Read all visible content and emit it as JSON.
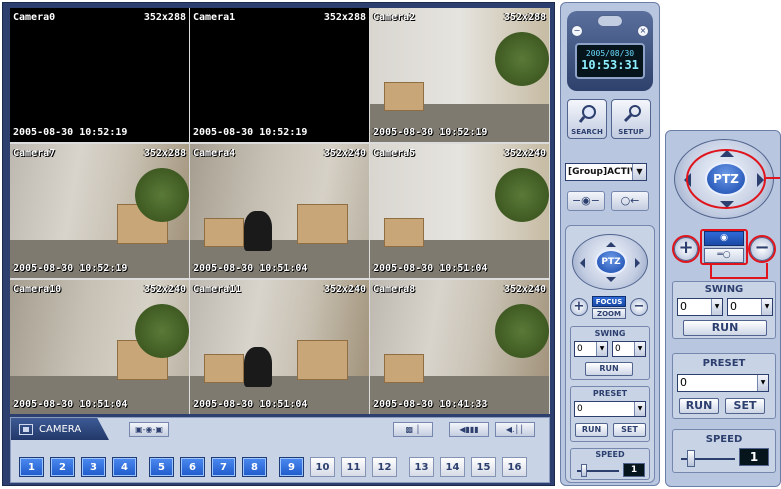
{
  "cameras": [
    {
      "name": "Camera0",
      "res": "352x288",
      "time": "2005-08-30 10:52:19",
      "live": false
    },
    {
      "name": "Camera1",
      "res": "352x288",
      "time": "2005-08-30 10:52:19",
      "live": false
    },
    {
      "name": "Camera2",
      "res": "352x288",
      "time": "2005-08-30 10:52:19",
      "live": true
    },
    {
      "name": "Camera7",
      "res": "352x288",
      "time": "2005-08-30 10:52:19",
      "live": true
    },
    {
      "name": "Camera4",
      "res": "352x240",
      "time": "2005-08-30 10:51:04",
      "live": true
    },
    {
      "name": "Camera5",
      "res": "352x240",
      "time": "2005-08-30 10:51:04",
      "live": true
    },
    {
      "name": "Camera10",
      "res": "352x240",
      "time": "2005-08-30 10:51:04",
      "live": true
    },
    {
      "name": "Camera11",
      "res": "352x240",
      "time": "2005-08-30 10:51:04",
      "live": true
    },
    {
      "name": "Camera8",
      "res": "352x240",
      "time": "2005-08-30 10:41:33",
      "live": true
    }
  ],
  "bottombar": {
    "tab_label": "CAMERA",
    "channel_buttons": [
      {
        "label": "1",
        "on": true
      },
      {
        "label": "2",
        "on": true
      },
      {
        "label": "3",
        "on": true
      },
      {
        "label": "4",
        "on": true
      },
      {
        "label": "5",
        "on": true
      },
      {
        "label": "6",
        "on": true
      },
      {
        "label": "7",
        "on": true
      },
      {
        "label": "8",
        "on": true
      },
      {
        "label": "9",
        "on": true
      },
      {
        "label": "10",
        "on": false
      },
      {
        "label": "11",
        "on": false
      },
      {
        "label": "12",
        "on": false
      },
      {
        "label": "13",
        "on": false
      },
      {
        "label": "14",
        "on": false
      },
      {
        "label": "15",
        "on": false
      },
      {
        "label": "16",
        "on": false
      }
    ]
  },
  "side": {
    "clock_date": "2005/08/30",
    "clock_time": "10:53:31",
    "search_label": "SEARCH",
    "setup_label": "SETUP",
    "group_value": "[Group]ACTIV",
    "ptz_label": "PTZ",
    "focus_label": "FOCUS",
    "zoom_label": "ZOOM",
    "swing_title": "SWING",
    "swing_a": "0",
    "swing_b": "0",
    "run_label": "RUN",
    "preset_title": "PRESET",
    "preset_value": "0",
    "set_label": "SET",
    "speed_title": "SPEED",
    "speed_value": "1"
  },
  "colors": {
    "accent": "#2e5fbd",
    "panel": "#b9c6df",
    "highlight": "#e0141c"
  }
}
